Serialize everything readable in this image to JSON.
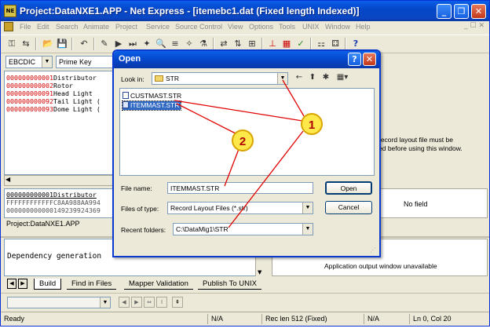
{
  "window": {
    "title": "Project:DataNXE1.APP - Net Express - [itemebc1.dat (Fixed length Indexed)]",
    "app_icon_text": "NE",
    "caption_minimize": "_",
    "caption_restore": "❐",
    "caption_close": "✕"
  },
  "menu": {
    "items": [
      "File",
      "Edit",
      "Search",
      "Animate",
      "Project",
      "Service",
      "Source Control",
      "View",
      "Options",
      "Tools",
      "UNIX",
      "Window",
      "Help"
    ],
    "restore_controls": "_ ☐ ✕"
  },
  "toolbar2": {
    "encoding": "EBCDIC",
    "key": "Prime Key"
  },
  "editor": {
    "records": [
      {
        "num": "000000000001",
        "text": "Distributor"
      },
      {
        "num": "000000000002",
        "text": "Rotor"
      },
      {
        "num": "000000000091",
        "text": "Head Light"
      },
      {
        "num": "000000000092",
        "text": "Tail Light ("
      },
      {
        "num": "000000000093",
        "text": "Dome Light ("
      }
    ]
  },
  "hex_pane": {
    "lines": [
      "000000000001Distributor",
      "FFFFFFFFFFFFC8AA988AA994",
      "000000000000149239924369"
    ]
  },
  "project_tab": "Project:DataNXE1.APP",
  "layout_msg": {
    "line1": "record layout file must be",
    "line2": "ed before using this window."
  },
  "no_field": "No field",
  "output": {
    "text": "Dependency generation",
    "app_output_msg": "Application output window unavailable"
  },
  "bottom_tabs": [
    "Build",
    "Find in Files",
    "Mapper Validation",
    "Publish To UNIX"
  ],
  "status": {
    "ready": "Ready",
    "na1": "N/A",
    "rec_len": "Rec len 512  (Fixed)",
    "na2": "N/A",
    "position": "Ln 0, Col 20"
  },
  "open_dialog": {
    "title": "Open",
    "help_btn": "?",
    "close_btn": "✕",
    "look_in_label": "Look in:",
    "look_in_value": "STR",
    "files": [
      {
        "name": "CUSTMAST.STR",
        "selected": false
      },
      {
        "name": "ITEMMAST.STR",
        "selected": true
      }
    ],
    "file_name_label": "File name:",
    "file_name_value": "ITEMMAST.STR",
    "files_of_type_label": "Files of type:",
    "files_of_type_value": "Record Layout Files (*.str)",
    "recent_label": "Recent folders:",
    "recent_value": "C:\\DataMig1\\STR",
    "open_btn": "Open",
    "cancel_btn": "Cancel"
  },
  "callouts": {
    "one": "1",
    "two": "2",
    "color_fill": "#ffe94a",
    "color_stroke": "#d9a400",
    "line_color": "#e00000"
  }
}
